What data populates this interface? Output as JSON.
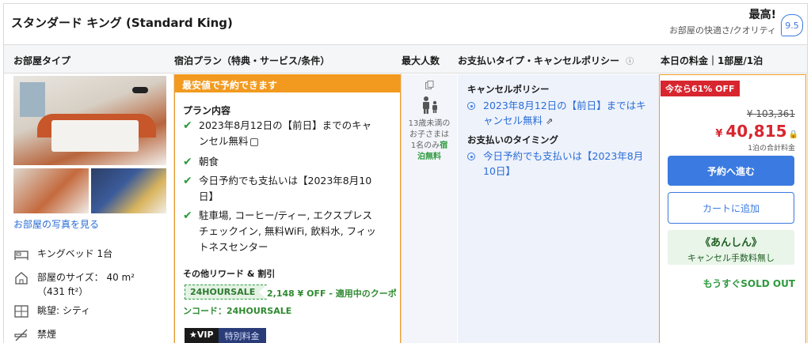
{
  "header": {
    "room_title": "スタンダード キング (Standard King)",
    "rating_title": "最高!",
    "rating_sub": "お部屋の快適さ/クオリティ",
    "rating_score": "9.5"
  },
  "columns": {
    "room_type": "お部屋タイプ",
    "plan": "宿泊プラン（特典・サービス/条件）",
    "max_guests": "最大人数",
    "payment": "お支払いタイプ・キャンセルポリシー",
    "payment_info": "ⓘ",
    "price": "本日の料金｜1部屋/1泊"
  },
  "room": {
    "photos_link": "お部屋の写真を見る",
    "features": [
      {
        "icon": "bed-icon",
        "label": "キングベッド 1台"
      },
      {
        "icon": "room-size-icon",
        "label": "部屋のサイズ： 40 m²（431 ft²）"
      },
      {
        "icon": "view-icon",
        "label": "眺望: シティ"
      },
      {
        "icon": "no-smoking-icon",
        "label": "禁煙"
      }
    ]
  },
  "plan": {
    "banner": "最安値で予約できます",
    "contents_heading": "プラン内容",
    "items": [
      "2023年8月12日の【前日】までのキャンセル無料",
      "朝食",
      "今日予約でも支払いは【2023年8月10日】",
      "駐車場, コーヒー/ティー, エクスプレスチェックイン, 無料WiFi, 飲料水, フィットネスセンター"
    ],
    "rewards_heading": "その他リワード & 割引",
    "coupon_tag": "24HOURSALE",
    "coupon_text_1": "2,148 ¥ OFF - 適用中のクーポ",
    "coupon_text_2": "ンコード：24HOURSALE",
    "vip_label": "★VIP",
    "vip_special": "特別料金"
  },
  "occupancy": {
    "child_note_1": "13歳未満の",
    "child_note_2": "お子さまは",
    "child_note_3": "1名のみ",
    "child_free_1": "宿",
    "child_free_2": "泊無料"
  },
  "cancellation": {
    "policy_heading": "キャンセルポリシー",
    "policy_text": "2023年8月12日の【前日】まではキャンセル無料",
    "timing_heading": "お支払いのタイミング",
    "timing_text": "今日予約でも支払いは【2023年8月10日】"
  },
  "price": {
    "sale_badge": "今なら61% OFF",
    "old_price": "¥ 103,361",
    "currency": "¥",
    "new_price": "40,815",
    "note": "1泊の合計料金",
    "book_button": "予約へ進む",
    "cart_button": "カートに追加",
    "anshin_title": "《あんしん》",
    "anshin_sub": "キャンセル手数料無し",
    "soldout": "もうすぐSOLD OUT"
  },
  "colors": {
    "accent_blue": "#3b7ae0",
    "deal_orange": "#f29a1f",
    "sale_red": "#d8262f",
    "free_green": "#2e9a3e"
  }
}
